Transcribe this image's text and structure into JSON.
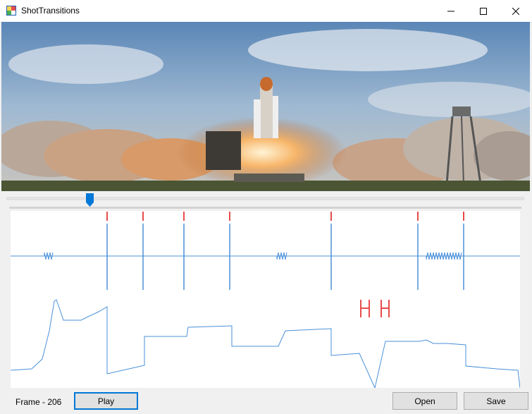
{
  "window": {
    "title": "ShotTransitions",
    "controls": [
      "minimize",
      "maximize",
      "close"
    ]
  },
  "video": {
    "content": "Space shuttle launch on pad with smoke clouds and water tower"
  },
  "seek_slider": {
    "position": 0.16
  },
  "graph": {
    "shot_markers": [
      0.19,
      0.26,
      0.34,
      0.43,
      0.63,
      0.8,
      0.89
    ],
    "top_signal_color": "#4a90d9",
    "marker_color": "#e84c4c",
    "annotation_color": "#e84c4c"
  },
  "status": {
    "frame_label": "Frame - 206"
  },
  "buttons": {
    "play": "Play",
    "open": "Open",
    "save": "Save"
  },
  "colors": {
    "accent": "#0078d7",
    "signal": "#4a90d9",
    "marker": "#e84c4c"
  }
}
